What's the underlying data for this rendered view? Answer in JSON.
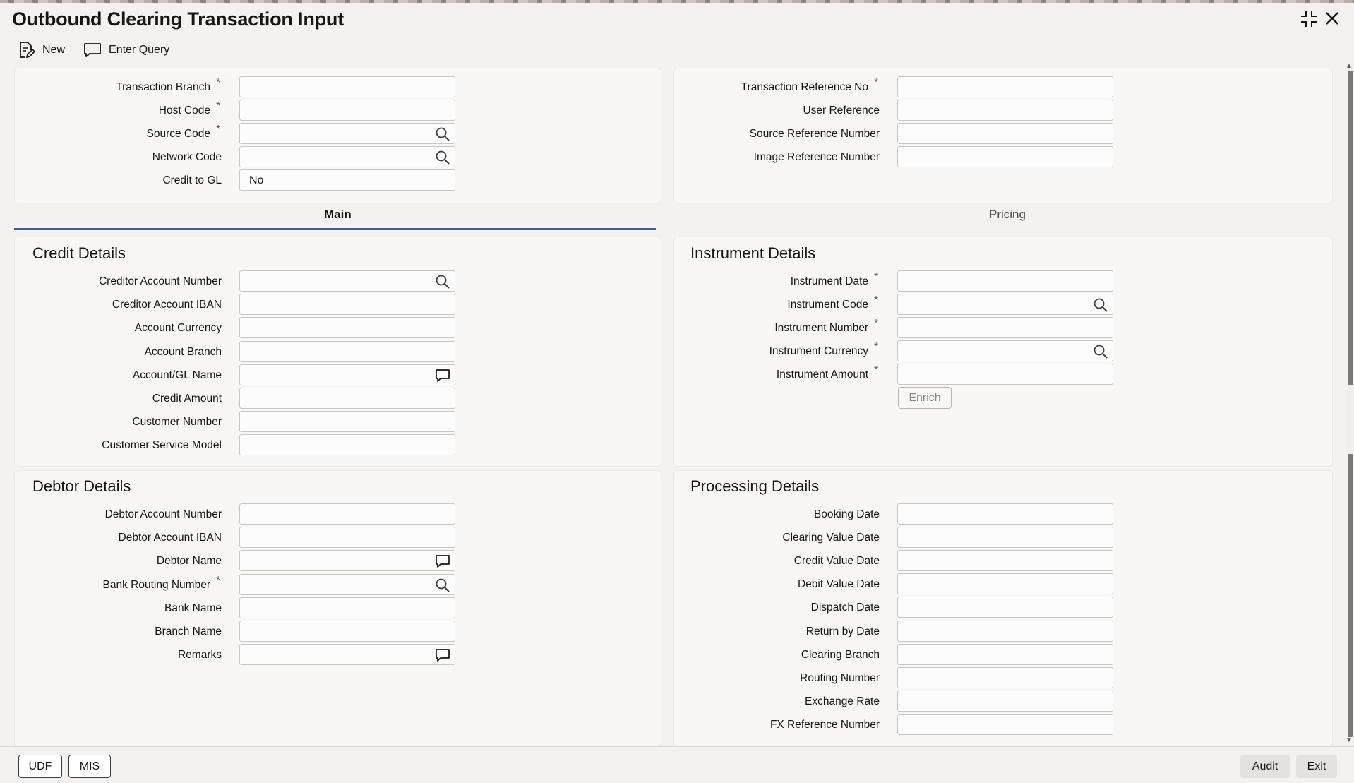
{
  "window": {
    "title": "Outbound Clearing Transaction Input",
    "maximize_glyph": "⛶",
    "close_glyph": "✕"
  },
  "toolbar": {
    "new_label": "New",
    "enter_query_label": "Enter Query"
  },
  "header_left": [
    {
      "label": "Transaction Branch",
      "required": true,
      "value": "",
      "icon": null
    },
    {
      "label": "Host Code",
      "required": true,
      "value": "",
      "icon": null
    },
    {
      "label": "Source Code",
      "required": true,
      "value": "",
      "icon": "search-icon"
    },
    {
      "label": "Network Code",
      "required": false,
      "value": "",
      "icon": "search-icon"
    },
    {
      "label": "Credit to GL",
      "required": false,
      "value": "No",
      "icon": null
    }
  ],
  "header_right": [
    {
      "label": "Transaction Reference No",
      "required": true,
      "value": ""
    },
    {
      "label": "User Reference",
      "required": false,
      "value": ""
    },
    {
      "label": "Source Reference Number",
      "required": false,
      "value": ""
    },
    {
      "label": "Image Reference Number",
      "required": false,
      "value": ""
    }
  ],
  "tabs": {
    "main": "Main",
    "pricing": "Pricing",
    "active": "Main"
  },
  "credit_details": {
    "title": "Credit Details",
    "fields": [
      {
        "label": "Creditor Account Number",
        "required": false,
        "icon": "search-icon"
      },
      {
        "label": "Creditor Account IBAN",
        "required": false,
        "icon": null
      },
      {
        "label": "Account Currency",
        "required": false,
        "icon": null
      },
      {
        "label": "Account Branch",
        "required": false,
        "icon": null
      },
      {
        "label": "Account/GL Name",
        "required": false,
        "icon": "comment-icon"
      },
      {
        "label": "Credit Amount",
        "required": false,
        "icon": null
      },
      {
        "label": "Customer Number",
        "required": false,
        "icon": null
      },
      {
        "label": "Customer Service Model",
        "required": false,
        "icon": null
      }
    ]
  },
  "instrument_details": {
    "title": "Instrument Details",
    "fields": [
      {
        "label": "Instrument Date",
        "required": true,
        "icon": null
      },
      {
        "label": "Instrument Code",
        "required": true,
        "icon": "search-icon"
      },
      {
        "label": "Instrument Number",
        "required": true,
        "icon": null
      },
      {
        "label": "Instrument Currency",
        "required": true,
        "icon": "search-icon"
      },
      {
        "label": "Instrument Amount",
        "required": true,
        "icon": null
      }
    ],
    "enrich_label": "Enrich"
  },
  "debtor_details": {
    "title": "Debtor Details",
    "fields": [
      {
        "label": "Debtor Account Number",
        "required": false,
        "icon": null
      },
      {
        "label": "Debtor Account IBAN",
        "required": false,
        "icon": null
      },
      {
        "label": "Debtor Name",
        "required": false,
        "icon": "comment-icon"
      },
      {
        "label": "Bank Routing Number",
        "required": true,
        "icon": "search-icon"
      },
      {
        "label": "Bank Name",
        "required": false,
        "icon": null
      },
      {
        "label": "Branch Name",
        "required": false,
        "icon": null
      },
      {
        "label": "Remarks",
        "required": false,
        "icon": "comment-icon"
      }
    ]
  },
  "processing_details": {
    "title": "Processing Details",
    "fields": [
      {
        "label": "Booking Date"
      },
      {
        "label": "Clearing Value Date"
      },
      {
        "label": "Credit Value Date"
      },
      {
        "label": "Debit Value Date"
      },
      {
        "label": "Dispatch Date"
      },
      {
        "label": "Return by Date"
      },
      {
        "label": "Clearing Branch"
      },
      {
        "label": "Routing Number"
      },
      {
        "label": "Exchange Rate"
      },
      {
        "label": "FX Reference Number"
      }
    ]
  },
  "footer": {
    "udf_label": "UDF",
    "mis_label": "MIS",
    "audit_label": "Audit",
    "exit_label": "Exit"
  },
  "required_mark": "*",
  "colors": {
    "accent": "#4a5d82",
    "background": "#f3f2f0",
    "panel": "#f8f7f6"
  }
}
